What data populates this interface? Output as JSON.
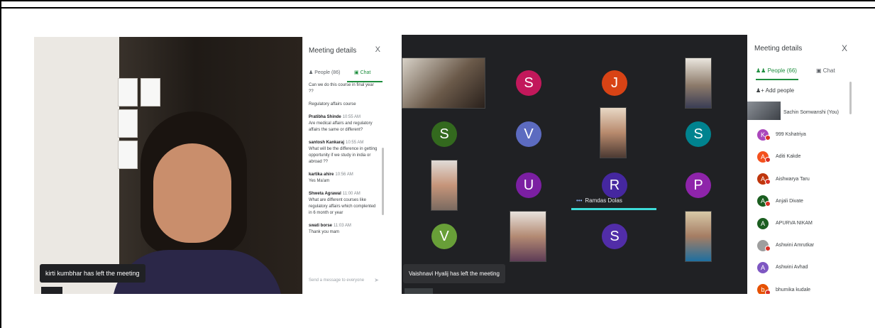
{
  "left_screenshot": {
    "toast": "kirti kumbhar has left the meeting",
    "panel": {
      "title": "Meeting details",
      "close_glyph": "X",
      "tabs": [
        {
          "label": "People (86)",
          "icon": "people-icon"
        },
        {
          "label": "Chat",
          "icon": "chat-icon"
        }
      ],
      "messages": [
        {
          "name": "",
          "time": "",
          "text": "Can we do this course in final year ??"
        },
        {
          "name": "",
          "time": "",
          "text": "Regulatory affairs course"
        },
        {
          "name": "Pratibha Shinde",
          "time": "10:55 AM",
          "text": "Are medical affairs and regulatory affairs the same or different?"
        },
        {
          "name": "santosh Kankaraj",
          "time": "10:55 AM",
          "text": "What will be the difference in getting opportunity if we study in india or abroad ??"
        },
        {
          "name": "kartika ahire",
          "time": "10:56 AM",
          "text": "Yes Ma'am"
        },
        {
          "name": "Shweta Agrawal",
          "time": "11:00 AM",
          "text": "What are different courses like regulatory affairs which complented in 6 month or year"
        },
        {
          "name": "swati borse",
          "time": "11:03 AM",
          "text": "Thank you mam"
        }
      ],
      "input_placeholder": "Send a message to everyone"
    }
  },
  "right_screenshot": {
    "grid": {
      "avatars": [
        {
          "letter": "S",
          "color": "#c2185b"
        },
        {
          "letter": "J",
          "color": "#d84315"
        },
        {
          "letter": "S",
          "color": "#33691e"
        },
        {
          "letter": "V",
          "color": "#5c6bc0"
        },
        {
          "letter": "S",
          "color": "#00838f"
        },
        {
          "letter": "U",
          "color": "#7b1fa2"
        },
        {
          "letter": "R",
          "color": "#4527a0"
        },
        {
          "letter": "P",
          "color": "#8e24aa"
        },
        {
          "letter": "V",
          "color": "#689f38"
        },
        {
          "letter": "S",
          "color": "#512da8"
        }
      ],
      "active_speaker": "Ramdas Dolas"
    },
    "toast": "Vaishnavi Hyalij has left the meeting",
    "panel": {
      "title": "Meeting details",
      "close_glyph": "X",
      "tabs": [
        {
          "label": "People (66)",
          "icon": "people-icon"
        },
        {
          "label": "Chat",
          "icon": "chat-icon"
        }
      ],
      "add_people": "Add people",
      "participants": [
        {
          "name": "Sachin Somwanshi (You)",
          "initial": "",
          "color": "#5f6368",
          "muted": false
        },
        {
          "name": "999 Kshatriya",
          "initial": "K",
          "color": "#ab47bc",
          "muted": true
        },
        {
          "name": "Aditi Kakde",
          "initial": "A",
          "color": "#f4511e",
          "muted": true
        },
        {
          "name": "Aishwarya Taru",
          "initial": "A",
          "color": "#bf360c",
          "muted": true
        },
        {
          "name": "Anjali Divate",
          "initial": "A",
          "color": "#1b5e20",
          "muted": true
        },
        {
          "name": "APURVA NIKAM",
          "initial": "A",
          "color": "#1b5e20",
          "muted": false
        },
        {
          "name": "Ashwini Amrutkar",
          "initial": "",
          "color": "#9e9e9e",
          "muted": true
        },
        {
          "name": "Ashwini Avhad",
          "initial": "A",
          "color": "#7e57c2",
          "muted": false
        },
        {
          "name": "bhumika kudale",
          "initial": "b",
          "color": "#e65100",
          "muted": true
        }
      ]
    }
  }
}
